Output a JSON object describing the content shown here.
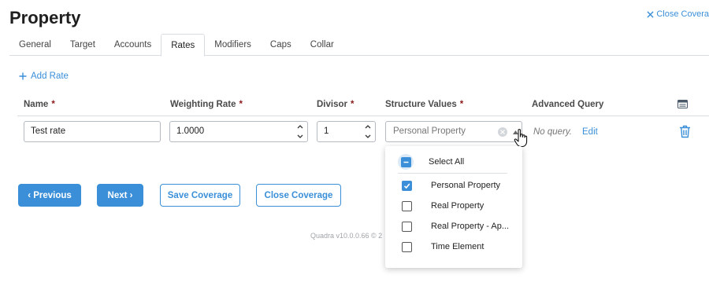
{
  "page": {
    "title": "Property",
    "close_label": "Close Covera"
  },
  "tabs": [
    {
      "label": "General"
    },
    {
      "label": "Target"
    },
    {
      "label": "Accounts"
    },
    {
      "label": "Rates",
      "active": true
    },
    {
      "label": "Modifiers"
    },
    {
      "label": "Caps"
    },
    {
      "label": "Collar"
    }
  ],
  "add_rate_label": "Add Rate",
  "columns": {
    "name": "Name",
    "weighting_rate": "Weighting Rate",
    "divisor": "Divisor",
    "structure_values": "Structure Values",
    "advanced_query": "Advanced Query",
    "required_marker": "*"
  },
  "row": {
    "name": "Test rate",
    "weighting_rate": "1.0000",
    "divisor": "1",
    "structure_values_placeholder": "Personal Property",
    "advanced_query": "No query.",
    "edit_label": "Edit"
  },
  "dropdown": {
    "select_all_label": "Select All",
    "options": [
      {
        "label": "Personal Property",
        "checked": true
      },
      {
        "label": "Real Property",
        "checked": false
      },
      {
        "label": "Real Property - Ap...",
        "checked": false
      },
      {
        "label": "Time Element",
        "checked": false
      }
    ]
  },
  "buttons": {
    "previous": "‹ Previous",
    "next": "Next ›",
    "save_coverage": "Save Coverage",
    "close_coverage": "Close Coverage"
  },
  "footer": {
    "version": "Quadra v10.0.0.66 © 2"
  },
  "colors": {
    "accent": "#3a8fd8",
    "required": "#8b1a1a",
    "border": "#b4bac1"
  },
  "icons": [
    "close-x-icon",
    "plus-icon",
    "table-settings-icon",
    "spinner-icon",
    "clear-icon",
    "caret-up-icon",
    "pointer-hand-icon",
    "trash-icon",
    "check-icon",
    "minus-icon"
  ]
}
